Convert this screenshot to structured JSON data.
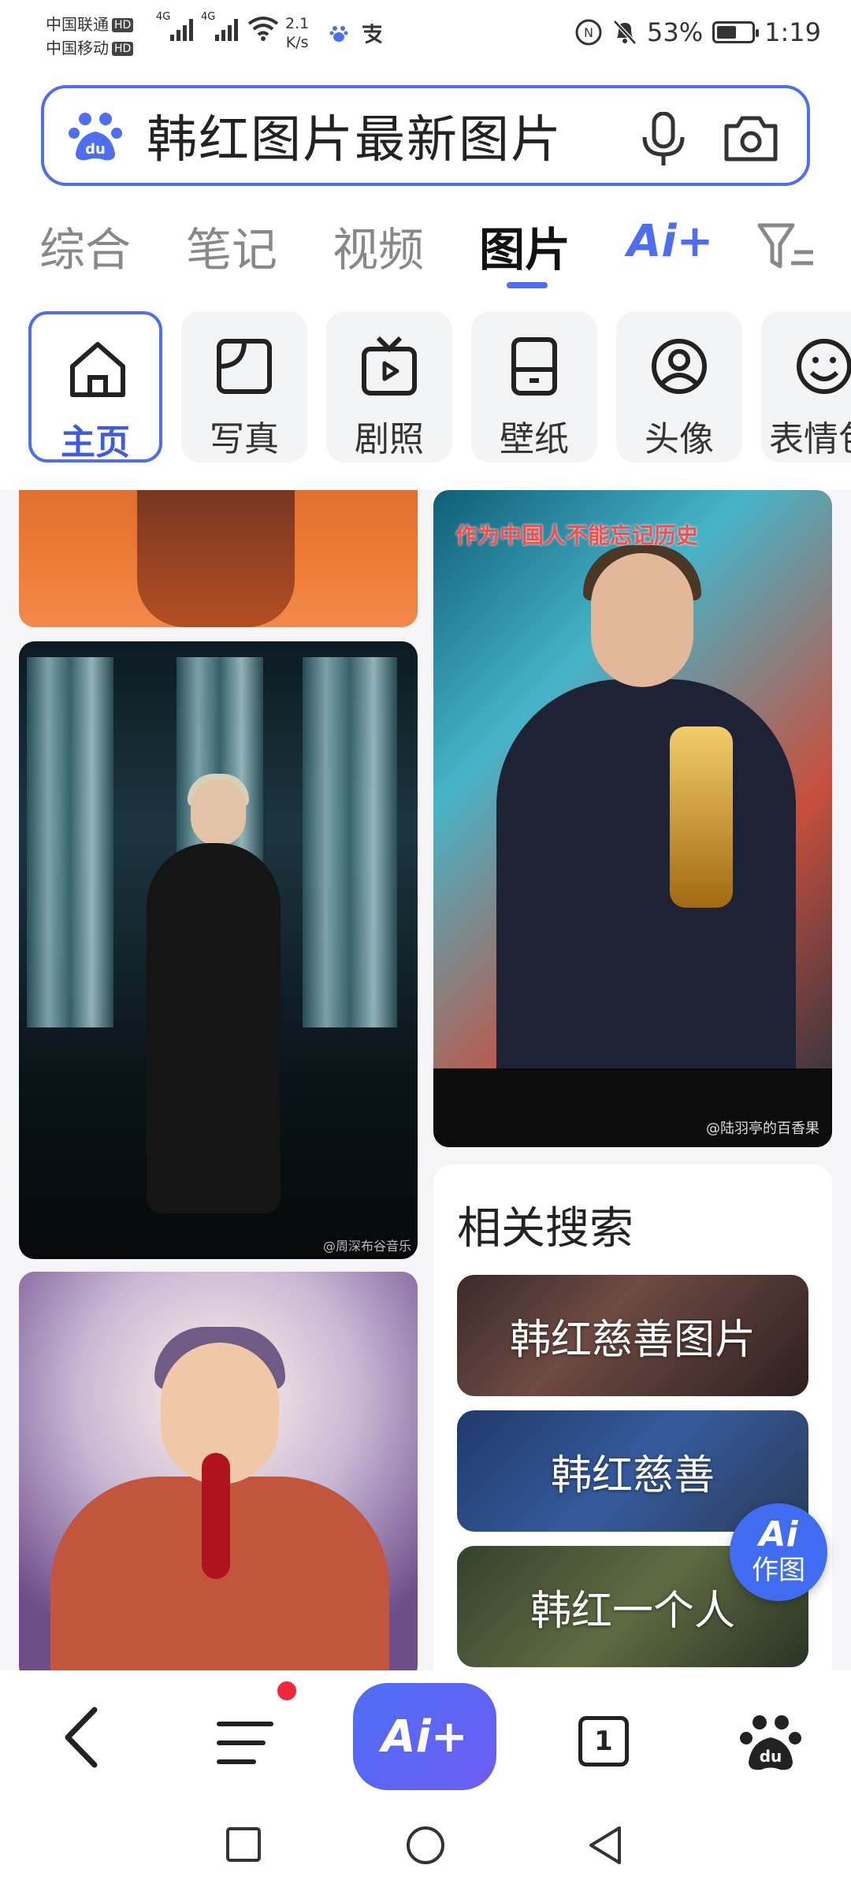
{
  "status_bar": {
    "carrier1": "中国联通",
    "carrier2": "中国移动",
    "hd": "HD",
    "net1": "4G",
    "net2": "4G",
    "speed_value": "2.1",
    "speed_unit": "K/s",
    "battery": "53%",
    "time": "1:19"
  },
  "search": {
    "query": "韩红图片最新图片",
    "logo_text": "du"
  },
  "tabs": {
    "items": [
      "综合",
      "笔记",
      "视频",
      "图片"
    ],
    "active": "图片",
    "ai": "Ai+"
  },
  "categories": {
    "items": [
      "主页",
      "写真",
      "剧照",
      "壁纸",
      "头像",
      "表情包"
    ],
    "active": "主页"
  },
  "feed": {
    "card_caption": "作为中国人不能忘记历史",
    "card_watermark": "@陆羽亭的百香果",
    "card2_watermark": "@周深布谷音乐"
  },
  "related": {
    "title": "相关搜索",
    "items": [
      "韩红慈善图片",
      "韩红慈善",
      "韩红一个人"
    ]
  },
  "ai_fab": {
    "line1": "Ai",
    "line2": "作图"
  },
  "bottom_bar": {
    "ai_label": "Ai+",
    "tab_count": "1"
  },
  "colors": {
    "accent": "#4e6ef2",
    "badge": "#f0263c"
  }
}
